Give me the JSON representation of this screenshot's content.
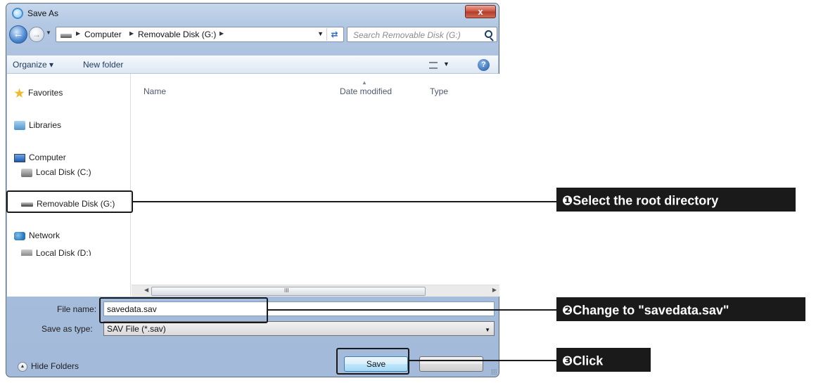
{
  "window": {
    "title": "Save As",
    "close_label": "x"
  },
  "navigation": {
    "address_segments": [
      "Computer",
      "Removable Disk (G:)"
    ],
    "search_placeholder": "Search Removable Disk (G:)"
  },
  "toolbar": {
    "organize_label": "Organize ▾",
    "new_folder_label": "New folder"
  },
  "nav_pane": {
    "favorites": "Favorites",
    "libraries": "Libraries",
    "computer": "Computer",
    "drives": [
      "Local Disk (C:)",
      "Local Disk (D:)",
      "Removable Disk (G:)"
    ],
    "network": "Network"
  },
  "file_list": {
    "columns": [
      "Name",
      "Date modified",
      "Type"
    ],
    "scroll_grip": "III"
  },
  "form": {
    "file_name_label": "File name:",
    "file_name_value": "savedata.sav",
    "save_type_label": "Save as type:",
    "save_type_value": "SAV File (*.sav)"
  },
  "footer": {
    "hide_folders_label": "Hide Folders",
    "save_button": "Save",
    "cancel_button": ""
  },
  "annotations": [
    {
      "number": "❶",
      "text": "Select the root directory"
    },
    {
      "number": "❷",
      "text": "Change to \"savedata.sav\""
    },
    {
      "number": "❸",
      "text": "Click"
    }
  ],
  "colors": {
    "dialog_frame": "#aac0de",
    "callout_bg": "#1a1a1a",
    "callout_text": "#ffffff",
    "save_button_accent": "#3c7fb1"
  }
}
